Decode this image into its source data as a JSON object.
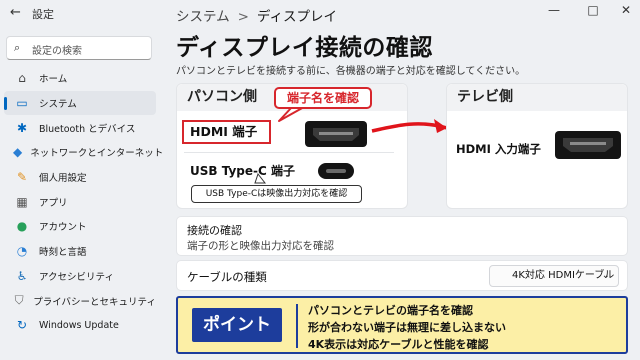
{
  "window": {
    "title": "設定",
    "back_icon": "←",
    "minimize": "—",
    "maximize": "□",
    "close": "✕"
  },
  "search": {
    "placeholder": "設定の検索",
    "icon": "⌕"
  },
  "sidebar": {
    "items": [
      {
        "label": "ホーム",
        "icon": "⌂",
        "color": "#444444",
        "active": false
      },
      {
        "label": "システム",
        "icon": "▭",
        "color": "#0067c0",
        "active": true
      },
      {
        "label": "Bluetooth とデバイス",
        "icon": "✱",
        "color": "#0067c0",
        "active": false
      },
      {
        "label": "ネットワークとインターネット",
        "icon": "◆",
        "color": "#2a7fd4",
        "active": false
      },
      {
        "label": "個人用設定",
        "icon": "✎",
        "color": "#e0901e",
        "active": false
      },
      {
        "label": "アプリ",
        "icon": "▦",
        "color": "#555555",
        "active": false
      },
      {
        "label": "アカウント",
        "icon": "●",
        "color": "#27a05a",
        "active": false
      },
      {
        "label": "時刻と言語",
        "icon": "◔",
        "color": "#2a7fd4",
        "active": false
      },
      {
        "label": "アクセシビリティ",
        "icon": "♿",
        "color": "#1b6fb8",
        "active": false
      },
      {
        "label": "プライバシーとセキュリティ",
        "icon": "⛉",
        "color": "#6b6b6b",
        "active": false
      },
      {
        "label": "Windows Update",
        "icon": "↻",
        "color": "#0067c0",
        "active": false
      }
    ]
  },
  "breadcrumb": {
    "parent": "システム",
    "separator": ">",
    "current": "ディスプレイ"
  },
  "page": {
    "title": "ディスプレイ接続の確認",
    "subtitle": "パソコンとテレビを接続する前に、各機器の端子と対応を確認してください。"
  },
  "pc_card": {
    "title": "パソコン側",
    "callout": "端子名を確認",
    "hdmi_label": "HDMI 端子",
    "usbc_label": "USB Type-C 端子",
    "usbc_note": "USB Type-Cは映像出力対応を確認"
  },
  "tv_card": {
    "title": "テレビ側",
    "hdmi_label": "HDMI 入力端子"
  },
  "connection": {
    "title": "接続の確認",
    "description": "端子の形と映像出力対応を確認"
  },
  "cable": {
    "label": "ケーブルの種類",
    "selected": "4K対応 HDMIケーブル",
    "chevron": "⌄"
  },
  "point": {
    "badge": "ポイント",
    "lines": [
      "パソコンとテレビの端子名を確認",
      "形が合わない端子は無理に差し込まない",
      "4K表示は対応ケーブルと性能を確認"
    ]
  },
  "colors": {
    "accent": "#0067c0",
    "callout_red": "#d7262c",
    "point_bg": "#fcefa6",
    "point_navy": "#1d3d9c"
  }
}
